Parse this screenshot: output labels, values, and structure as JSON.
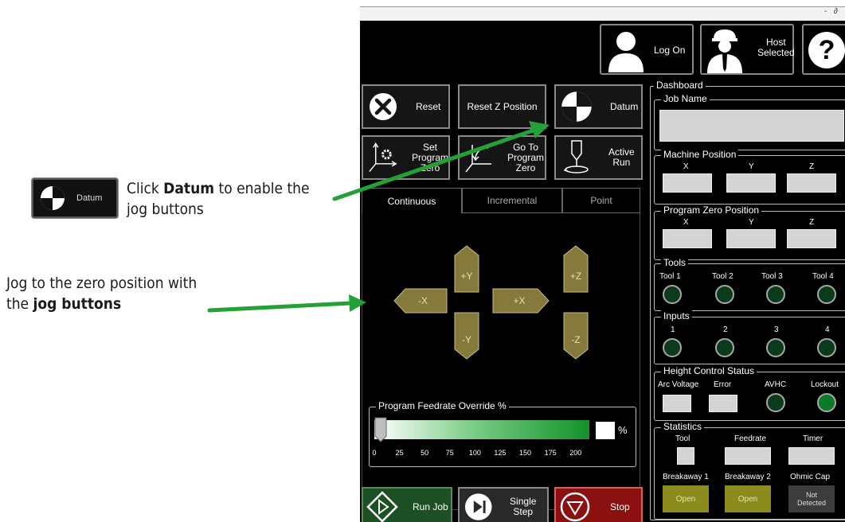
{
  "annotations": {
    "datum_button_label": "Datum",
    "datum_line1_pre": "Click ",
    "datum_line1_bold": "Datum",
    "datum_line1_post": " to enable the",
    "datum_line2": "jog buttons",
    "jog_line1": "Jog to the zero position with",
    "jog_line2_pre": "the ",
    "jog_line2_bold": "jog buttons"
  },
  "titlebar": {
    "controls": "- ∂"
  },
  "top_buttons": {
    "log_on": "Log On",
    "host_line1": "Host",
    "host_line2": "Selected",
    "help": "?"
  },
  "actions": {
    "reset": "Reset",
    "reset_z": "Reset Z Position",
    "datum": "Datum",
    "set_zero": [
      "Set",
      "Program",
      "Zero"
    ],
    "go_to_zero": [
      "Go To",
      "Program",
      "Zero"
    ],
    "active_run": [
      "Active",
      "Run"
    ]
  },
  "tabs": [
    "Continuous",
    "Incremental",
    "Point"
  ],
  "jog": {
    "plus_y": "+Y",
    "minus_y": "-Y",
    "minus_x": "-X",
    "plus_x": "+X",
    "plus_z": "+Z",
    "minus_z": "-Z"
  },
  "feedrate": {
    "title": "Program Feedrate Override %",
    "unit": "%",
    "ticks": [
      "0",
      "25",
      "50",
      "75",
      "100",
      "125",
      "150",
      "175",
      "200"
    ],
    "value_percent": 0
  },
  "bottom": {
    "run_job": "Run Job",
    "single_step": "Single Step",
    "stop": "Stop"
  },
  "dashboard": {
    "title": "Dashboard",
    "job_name": {
      "title": "Job Name",
      "value": ""
    },
    "machine_position": {
      "title": "Machine Position",
      "axes": [
        "X",
        "Y",
        "Z"
      ]
    },
    "program_zero": {
      "title": "Program Zero Position",
      "axes": [
        "X",
        "Y",
        "Z"
      ]
    },
    "tools": {
      "title": "Tools",
      "items": [
        "Tool 1",
        "Tool 2",
        "Tool 3",
        "Tool 4"
      ]
    },
    "inputs": {
      "title": "Inputs",
      "items": [
        "1",
        "2",
        "3",
        "4"
      ]
    },
    "height_control": {
      "title": "Height Control Status",
      "arc_voltage": "Arc Voltage",
      "error": "Error",
      "avhc": "AVHC",
      "lockout": "Lockout"
    },
    "statistics": {
      "title": "Statistics",
      "tool": "Tool",
      "feedrate": "Feedrate",
      "timer": "Timer",
      "breakaway1": "Breakaway 1",
      "breakaway2": "Breakaway 2",
      "ohmic_cap": "Ohmic Cap",
      "breakaway1_status": "Open",
      "breakaway2_status": "Open",
      "ohmic_status_line1": "Not",
      "ohmic_status_line2": "Detected"
    }
  },
  "colors": {
    "jog_button": "#857a3c",
    "arrow": "#23a136",
    "open_status": "#8c8c1e",
    "stop": "#8b1111",
    "run": "#1c4f24",
    "led_on": "#0d7a2a"
  }
}
